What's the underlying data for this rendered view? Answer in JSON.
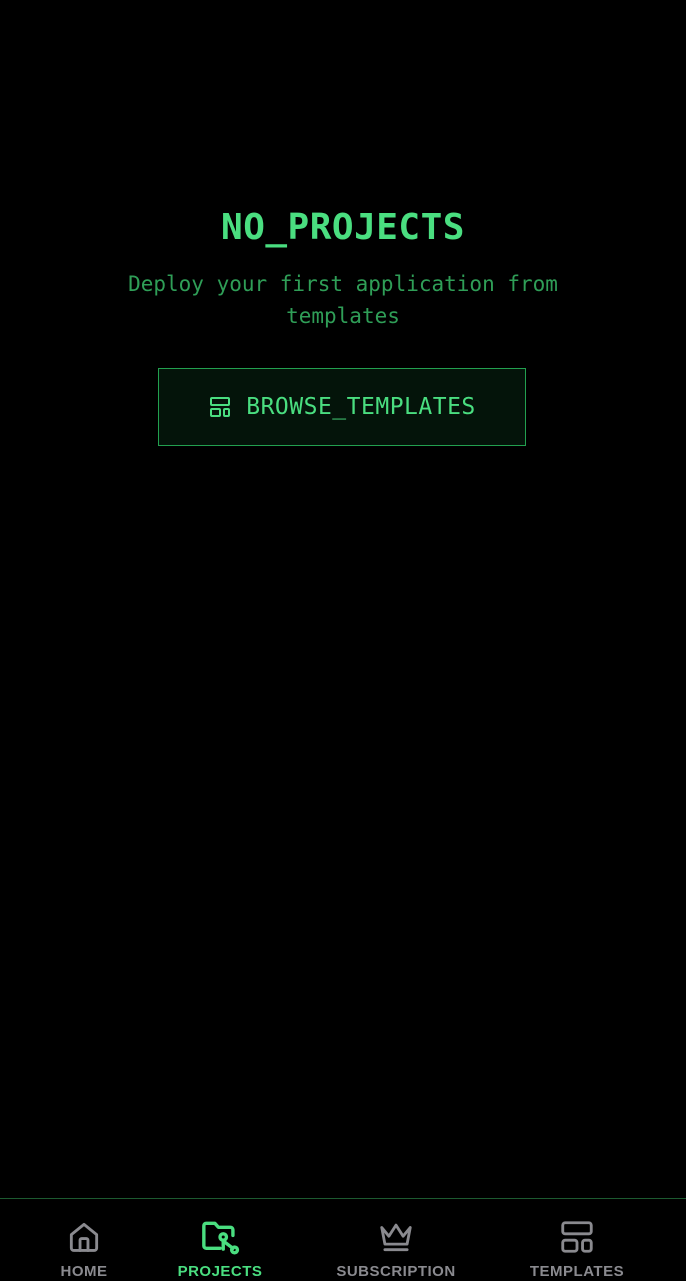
{
  "empty_state": {
    "title": "NO_PROJECTS",
    "subtitle": "Deploy your first application from templates",
    "browse_button_label": "BROWSE_TEMPLATES",
    "browse_button_icon": "templates-icon"
  },
  "bottom_nav": {
    "active": "projects",
    "items": [
      {
        "id": "home",
        "label": "HOME",
        "icon": "home-icon"
      },
      {
        "id": "projects",
        "label": "PROJECTS",
        "icon": "folder-git-icon"
      },
      {
        "id": "subscription",
        "label": "SUBSCRIPTION",
        "icon": "crown-icon"
      },
      {
        "id": "templates",
        "label": "TEMPLATES",
        "icon": "templates-icon"
      }
    ]
  },
  "colors": {
    "background": "#000000",
    "accent": "#4ade80",
    "accent_dim": "#2f9e57",
    "inactive": "#8a8a8f"
  }
}
